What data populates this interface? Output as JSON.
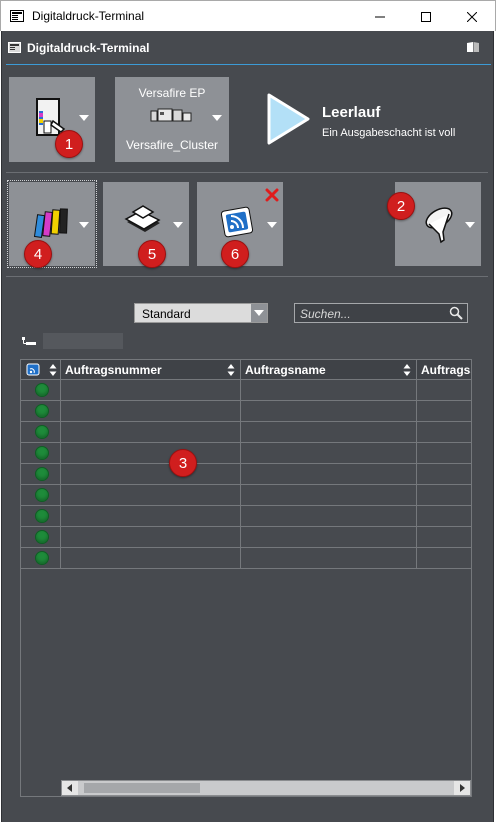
{
  "window": {
    "title": "Digitaldruck-Terminal"
  },
  "app": {
    "title": "Digitaldruck-Terminal"
  },
  "printer": {
    "model": "Versafire EP",
    "cluster": "Versafire_Cluster"
  },
  "status": {
    "state": "Leerlauf",
    "message": "Ein Ausgabeschacht ist voll"
  },
  "badges": {
    "b1": "1",
    "b2": "2",
    "b3": "3",
    "b4": "4",
    "b5": "5",
    "b6": "6"
  },
  "filter": {
    "selected": "Standard"
  },
  "search": {
    "placeholder": "Suchen..."
  },
  "table": {
    "columns": [
      "Auftragsnummer",
      "Auftragsname",
      "Auftragss"
    ],
    "row_count": 9
  },
  "colors": {
    "accent": "#3c9bd6",
    "panel": "#474a4f",
    "tile": "#8e9196",
    "badge": "#d01e1e",
    "status_ok": "#1e8b3a"
  }
}
